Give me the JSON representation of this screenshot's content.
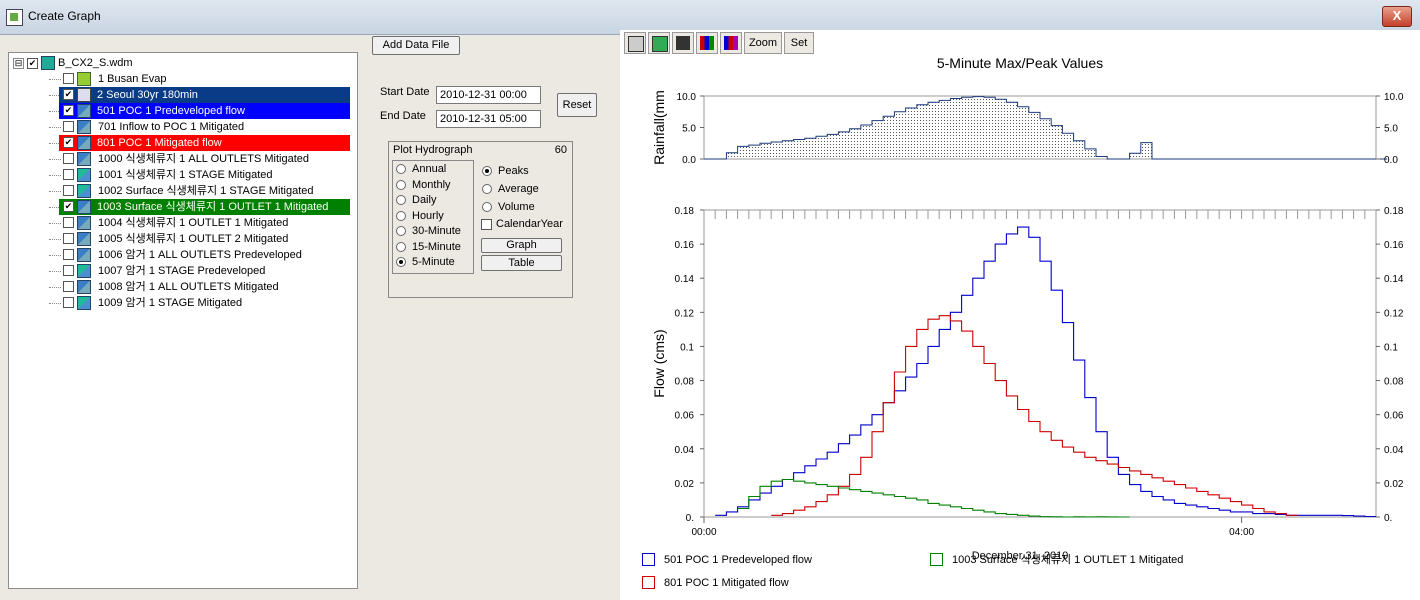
{
  "window": {
    "title": "Create Graph",
    "close_label": "X"
  },
  "tree": {
    "root_label": "B_CX2_S.wdm",
    "expander_label": "⊟",
    "items": [
      {
        "label": "1 Busan Evap",
        "checked": false,
        "icon": "evap-icon",
        "bg": ""
      },
      {
        "label": "2 Seoul 30yr 180min",
        "checked": true,
        "icon": "rain-icon",
        "bg": "#0a3b86"
      },
      {
        "label": "501 POC 1 Predeveloped flow",
        "checked": true,
        "icon": "flow-icon",
        "bg": "#0000ff"
      },
      {
        "label": "701 Inflow to POC 1 Mitigated",
        "checked": false,
        "icon": "flow-icon",
        "bg": ""
      },
      {
        "label": "801 POC 1 Mitigated flow",
        "checked": true,
        "icon": "flow-icon",
        "bg": "#ff0000"
      },
      {
        "label": "1000 식생체류지  1 ALL OUTLETS Mitigated",
        "checked": false,
        "icon": "flow-icon",
        "bg": ""
      },
      {
        "label": "1001 식생체류지  1 STAGE Mitigated",
        "checked": false,
        "icon": "stage-icon",
        "bg": ""
      },
      {
        "label": "1002 Surface 식생체류지  1 STAGE Mitigated",
        "checked": false,
        "icon": "stage-icon",
        "bg": ""
      },
      {
        "label": "1003 Surface 식생체류지  1 OUTLET 1 Mitigated",
        "checked": true,
        "icon": "flow-icon",
        "bg": "#008000"
      },
      {
        "label": "1004 식생체류지  1 OUTLET 1 Mitigated",
        "checked": false,
        "icon": "flow-icon",
        "bg": ""
      },
      {
        "label": "1005 식생체류지  1 OUTLET 2 Mitigated",
        "checked": false,
        "icon": "flow-icon",
        "bg": ""
      },
      {
        "label": "1006 암거  1 ALL OUTLETS Predeveloped",
        "checked": false,
        "icon": "flow-icon",
        "bg": ""
      },
      {
        "label": "1007 암거  1 STAGE Predeveloped",
        "checked": false,
        "icon": "stage-icon",
        "bg": ""
      },
      {
        "label": "1008 암거  1 ALL OUTLETS Mitigated",
        "checked": false,
        "icon": "flow-icon",
        "bg": ""
      },
      {
        "label": "1009 암거  1 STAGE Mitigated",
        "checked": false,
        "icon": "stage-icon",
        "bg": ""
      }
    ]
  },
  "controls": {
    "add_data_file": "Add Data File",
    "start_date_label": "Start Date",
    "start_date_value": "2010-12-31 00:00",
    "end_date_label": "End Date",
    "end_date_value": "2010-12-31 05:00",
    "reset": "Reset"
  },
  "plot_hydrograph": {
    "title": "Plot Hydrograph",
    "count": "60",
    "periods": [
      {
        "label": "Annual",
        "selected": false
      },
      {
        "label": "Monthly",
        "selected": false
      },
      {
        "label": "Daily",
        "selected": false
      },
      {
        "label": "Hourly",
        "selected": false
      },
      {
        "label": "30-Minute",
        "selected": false
      },
      {
        "label": "15-Minute",
        "selected": false
      },
      {
        "label": "5-Minute",
        "selected": true
      }
    ],
    "stats": [
      {
        "label": "Peaks",
        "selected": true
      },
      {
        "label": "Average",
        "selected": false
      },
      {
        "label": "Volume",
        "selected": false
      }
    ],
    "calendar_year": {
      "label": "CalendarYear",
      "checked": false
    },
    "graph_button": "Graph",
    "table_button": "Table"
  },
  "toolbar": {
    "print_icon": "printer-icon",
    "export_icon": "export-icon",
    "save_icon": "save-icon",
    "series1_icon": "series-a-icon",
    "series2_icon": "series-b-icon",
    "zoom": "Zoom",
    "set": "Set"
  },
  "legend": [
    {
      "label": "501 POC 1 Predeveloped flow",
      "color": "#0000cc"
    },
    {
      "label": "1003 Surface 식생체류지  1 OUTLET 1 Mitigated",
      "color": "#008000"
    },
    {
      "label": "801 POC 1 Mitigated flow",
      "color": "#cc0000"
    }
  ],
  "chart_data": {
    "type": "line",
    "title": "5-Minute Max/Peak Values",
    "xlabel": "December 31, 2010",
    "x_range_minutes": [
      0,
      300
    ],
    "x_ticks": [
      {
        "minute": 0,
        "label": "00:00"
      },
      {
        "minute": 240,
        "label": "04:00"
      }
    ],
    "rainfall": {
      "ylabel": "Rainfall(mm",
      "ylim": [
        0,
        10
      ],
      "ticks": [
        "0.0",
        "5.0",
        "10.0"
      ],
      "step_minutes": 5,
      "start_minute": 0,
      "values": [
        0,
        0,
        1.0,
        2.0,
        2.2,
        2.5,
        2.7,
        2.9,
        3.1,
        3.3,
        3.6,
        3.9,
        4.3,
        4.8,
        5.4,
        6.1,
        6.8,
        7.5,
        8.1,
        8.6,
        9.0,
        9.3,
        9.6,
        9.8,
        9.9,
        9.8,
        9.5,
        9.0,
        8.3,
        7.4,
        6.4,
        5.3,
        4.1,
        2.9,
        1.6,
        0.4,
        0,
        0,
        0.9,
        2.6,
        0,
        0,
        0,
        0,
        0,
        0,
        0,
        0,
        0,
        0,
        0,
        0,
        0,
        0,
        0,
        0,
        0,
        0,
        0,
        0,
        0
      ]
    },
    "flow": {
      "ylabel": "Flow  (cms)",
      "ylim": [
        0,
        0.18
      ],
      "ticks": [
        "0.",
        "0.02",
        "0.04",
        "0.06",
        "0.08",
        "0.1",
        "0.12",
        "0.14",
        "0.16",
        "0.18"
      ],
      "step_minutes": 5,
      "series": [
        {
          "name": "501 POC 1 Predeveloped flow",
          "color": "#0000cc",
          "start_minute": 5,
          "values": [
            0.001,
            0.003,
            0.006,
            0.01,
            0.014,
            0.018,
            0.022,
            0.026,
            0.03,
            0.034,
            0.038,
            0.043,
            0.048,
            0.054,
            0.06,
            0.067,
            0.074,
            0.082,
            0.09,
            0.1,
            0.11,
            0.12,
            0.13,
            0.14,
            0.15,
            0.16,
            0.166,
            0.17,
            0.164,
            0.15,
            0.133,
            0.114,
            0.092,
            0.07,
            0.05,
            0.035,
            0.025,
            0.019,
            0.015,
            0.012,
            0.01,
            0.008,
            0.007,
            0.006,
            0.005,
            0.004,
            0.003,
            0.003,
            0.002,
            0.002,
            0.0015,
            0.001,
            0.001,
            0.001,
            0.001,
            0.001,
            0.0008,
            0.0005,
            0.0003
          ]
        },
        {
          "name": "801 POC 1 Mitigated flow",
          "color": "#cc0000",
          "start_minute": 30,
          "values": [
            0.001,
            0.002,
            0.004,
            0.006,
            0.009,
            0.013,
            0.018,
            0.025,
            0.035,
            0.05,
            0.067,
            0.085,
            0.1,
            0.11,
            0.116,
            0.118,
            0.115,
            0.109,
            0.1,
            0.09,
            0.08,
            0.071,
            0.063,
            0.056,
            0.05,
            0.045,
            0.041,
            0.038,
            0.035,
            0.033,
            0.031,
            0.029,
            0.027,
            0.025,
            0.023,
            0.021,
            0.019,
            0.017,
            0.015,
            0.013,
            0.011,
            0.009,
            0.007,
            0.005,
            0.003,
            0.002,
            0.001
          ]
        },
        {
          "name": "1003 Surface 식생체류지  1 OUTLET 1 Mitigated",
          "color": "#008000",
          "start_minute": 15,
          "values": [
            0.005,
            0.012,
            0.018,
            0.021,
            0.022,
            0.021,
            0.02,
            0.019,
            0.018,
            0.017,
            0.016,
            0.015,
            0.014,
            0.013,
            0.012,
            0.011,
            0.01,
            0.008,
            0.007,
            0.006,
            0.005,
            0.004,
            0.003,
            0.002,
            0.0015,
            0.001,
            0.0005,
            0.0002,
            0.0001,
            0,
            0.0001,
            5e-05,
            0.0001,
            5e-05,
            0
          ]
        }
      ]
    },
    "grid": false,
    "legend_position": "bottom"
  }
}
